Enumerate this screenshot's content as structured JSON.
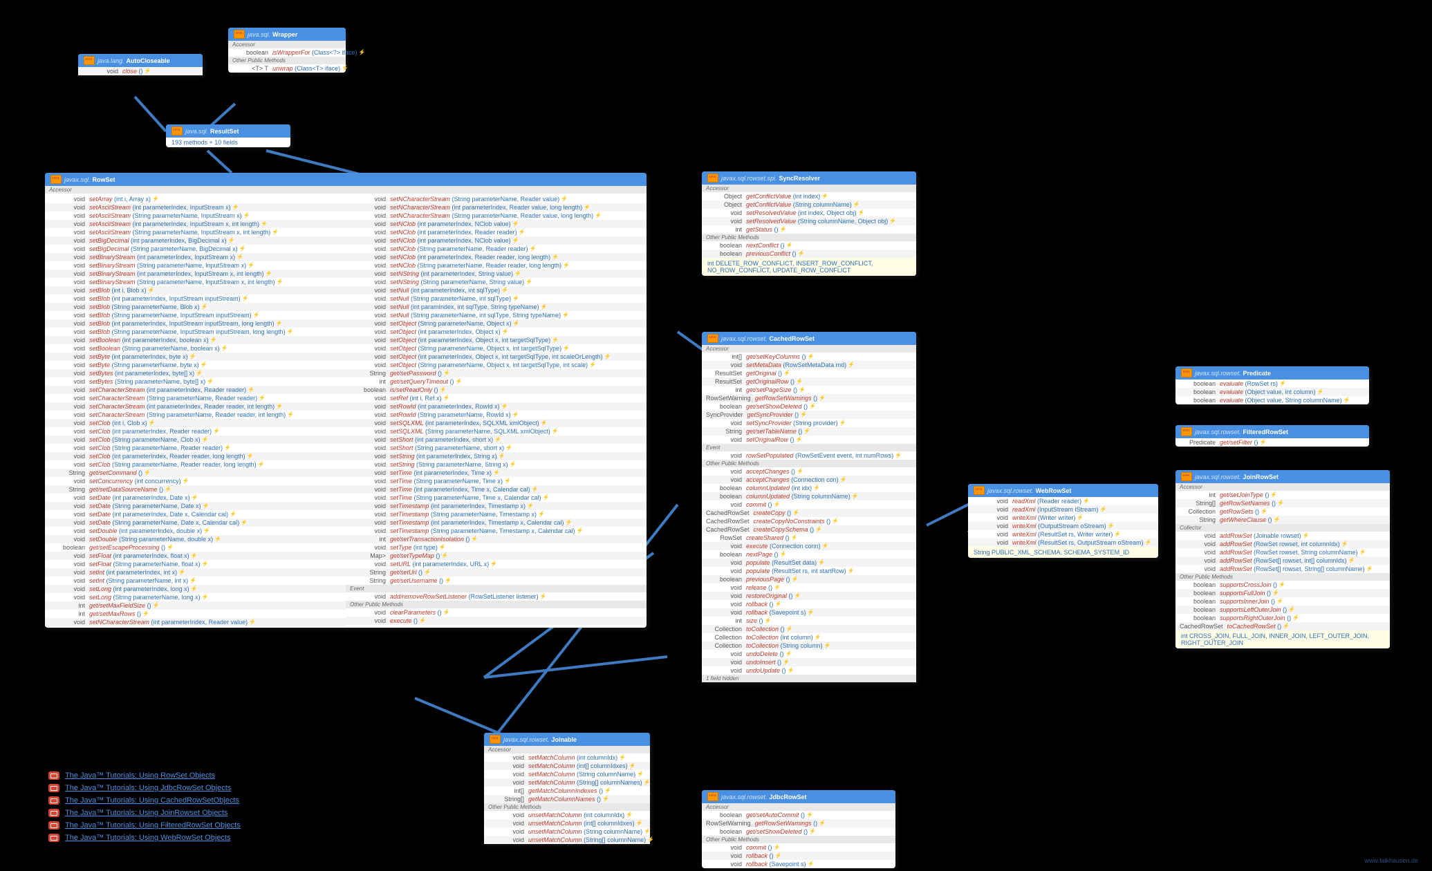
{
  "wrapper": {
    "pkg": "java.sql.",
    "name": "Wrapper",
    "sec1": "Accessor",
    "r1_ret": "boolean",
    "r1_m": "isWrapperFor",
    "r1_p": "(Class<?> iface)",
    "sec2": "Other Public Methods",
    "r2_ret": "<T> T",
    "r2_m": "unwrap",
    "r2_p": "(Class<T> iface)"
  },
  "autocloseable": {
    "pkg": "java.lang.",
    "name": "AutoCloseable",
    "r_ret": "void",
    "r_m": "close",
    "r_p": "()"
  },
  "resultset": {
    "pkg": "java.sql.",
    "name": "ResultSet",
    "info": "193 methods + 10 fields"
  },
  "rowset": {
    "pkg": "javax.sql.",
    "name": "RowSet",
    "sec1": "Accessor",
    "sec2": "Event",
    "col1": [
      [
        "void",
        "setArray",
        "(int i, Array x)"
      ],
      [
        "void",
        "setAsciiStream",
        "(int parameterIndex, InputStream x)"
      ],
      [
        "void",
        "setAsciiStream",
        "(String parameterName, InputStream x)"
      ],
      [
        "void",
        "setAsciiStream",
        "(int parameterIndex, InputStream x, int length)"
      ],
      [
        "void",
        "setAsciiStream",
        "(String parameterName, InputStream x, int length)"
      ],
      [
        "void",
        "setBigDecimal",
        "(int parameterIndex, BigDecimal x)"
      ],
      [
        "void",
        "setBigDecimal",
        "(String parameterName, BigDecimal x)"
      ],
      [
        "void",
        "setBinaryStream",
        "(int parameterIndex, InputStream x)"
      ],
      [
        "void",
        "setBinaryStream",
        "(String parameterName, InputStream x)"
      ],
      [
        "void",
        "setBinaryStream",
        "(int parameterIndex, InputStream x, int length)"
      ],
      [
        "void",
        "setBinaryStream",
        "(String parameterName, InputStream x, int length)"
      ],
      [
        "void",
        "setBlob",
        "(int i, Blob x)"
      ],
      [
        "void",
        "setBlob",
        "(int parameterIndex, InputStream inputStream)"
      ],
      [
        "void",
        "setBlob",
        "(String parameterName, Blob x)"
      ],
      [
        "void",
        "setBlob",
        "(String parameterName, InputStream inputStream)"
      ],
      [
        "void",
        "setBlob",
        "(int parameterIndex, InputStream inputStream, long length)"
      ],
      [
        "void",
        "setBlob",
        "(String parameterName, InputStream inputStream, long length)"
      ],
      [
        "void",
        "setBoolean",
        "(int parameterIndex, boolean x)"
      ],
      [
        "void",
        "setBoolean",
        "(String parameterName, boolean x)"
      ],
      [
        "void",
        "setByte",
        "(int parameterIndex, byte x)"
      ],
      [
        "void",
        "setByte",
        "(String parameterName, byte x)"
      ],
      [
        "void",
        "setBytes",
        "(int parameterIndex, byte[] x)"
      ],
      [
        "void",
        "setBytes",
        "(String parameterName, byte[] x)"
      ],
      [
        "void",
        "setCharacterStream",
        "(int parameterIndex, Reader reader)"
      ],
      [
        "void",
        "setCharacterStream",
        "(String parameterName, Reader reader)"
      ],
      [
        "void",
        "setCharacterStream",
        "(int parameterIndex, Reader reader, int length)"
      ],
      [
        "void",
        "setCharacterStream",
        "(String parameterName, Reader reader, int length)"
      ],
      [
        "void",
        "setClob",
        "(int i, Clob x)"
      ],
      [
        "void",
        "setClob",
        "(int parameterIndex, Reader reader)"
      ],
      [
        "void",
        "setClob",
        "(String parameterName, Clob x)"
      ],
      [
        "void",
        "setClob",
        "(String parameterName, Reader reader)"
      ],
      [
        "void",
        "setClob",
        "(int parameterIndex, Reader reader, long length)"
      ],
      [
        "void",
        "setClob",
        "(String parameterName, Reader reader, long length)"
      ],
      [
        "String",
        "get/setCommand",
        "()"
      ],
      [
        "void",
        "setConcurrency",
        "(int concurrency)"
      ],
      [
        "String",
        "get/setDataSourceName",
        "()"
      ],
      [
        "void",
        "setDate",
        "(int parameterIndex, Date x)"
      ],
      [
        "void",
        "setDate",
        "(String parameterName, Date x)"
      ],
      [
        "void",
        "setDate",
        "(int parameterIndex, Date x, Calendar cal)"
      ],
      [
        "void",
        "setDate",
        "(String parameterName, Date x, Calendar cal)"
      ],
      [
        "void",
        "setDouble",
        "(int parameterIndex, double x)"
      ],
      [
        "void",
        "setDouble",
        "(String parameterName, double x)"
      ],
      [
        "boolean",
        "get/setEscapeProcessing",
        "()"
      ],
      [
        "void",
        "setFloat",
        "(int parameterIndex, float x)"
      ],
      [
        "void",
        "setFloat",
        "(String parameterName, float x)"
      ],
      [
        "void",
        "setInt",
        "(int parameterIndex, int x)"
      ],
      [
        "void",
        "setInt",
        "(String parameterName, int x)"
      ],
      [
        "void",
        "setLong",
        "(int parameterIndex, long x)"
      ],
      [
        "void",
        "setLong",
        "(String parameterName, long x)"
      ],
      [
        "int",
        "get/setMaxFieldSize",
        "()"
      ],
      [
        "int",
        "get/setMaxRows",
        "()"
      ],
      [
        "void",
        "setNCharacterStream",
        "(int parameterIndex, Reader value)"
      ]
    ],
    "col2": [
      [
        "void",
        "setNCharacterStream",
        "(String parameterName, Reader value)"
      ],
      [
        "void",
        "setNCharacterStream",
        "(int parameterIndex, Reader value, long length)"
      ],
      [
        "void",
        "setNCharacterStream",
        "(String parameterName, Reader value, long length)"
      ],
      [
        "void",
        "setNClob",
        "(int parameterIndex, NClob value)"
      ],
      [
        "void",
        "setNClob",
        "(int parameterIndex, Reader reader)"
      ],
      [
        "void",
        "setNClob",
        "(int parameterIndex, NClob value)"
      ],
      [
        "void",
        "setNClob",
        "(String parameterName, Reader reader)"
      ],
      [
        "void",
        "setNClob",
        "(int parameterIndex, Reader reader, long length)"
      ],
      [
        "void",
        "setNClob",
        "(String parameterName, Reader reader, long length)"
      ],
      [
        "void",
        "setNString",
        "(int parameterIndex, String value)"
      ],
      [
        "void",
        "setNString",
        "(String parameterName, String value)"
      ],
      [
        "void",
        "setNull",
        "(int parameterIndex, int sqlType)"
      ],
      [
        "void",
        "setNull",
        "(String parameterName, int sqlType)"
      ],
      [
        "void",
        "setNull",
        "(int paramIndex, int sqlType, String typeName)"
      ],
      [
        "void",
        "setNull",
        "(String parameterName, int sqlType, String typeName)"
      ],
      [
        "void",
        "setObject",
        "(String parameterName, Object x)"
      ],
      [
        "void",
        "setObject",
        "(int parameterIndex, Object x)"
      ],
      [
        "void",
        "setObject",
        "(int parameterIndex, Object x, int targetSqlType)"
      ],
      [
        "void",
        "setObject",
        "(String parameterName, Object x, int targetSqlType)"
      ],
      [
        "void",
        "setObject",
        "(int parameterIndex, Object x, int targetSqlType, int scaleOrLength)"
      ],
      [
        "void",
        "setObject",
        "(String parameterName, Object x, int targetSqlType, int scale)"
      ],
      [
        "String",
        "get/setPassword",
        "()"
      ],
      [
        "int",
        "get/setQueryTimeout",
        "()"
      ],
      [
        "boolean",
        "is/setReadOnly",
        "()"
      ],
      [
        "void",
        "setRef",
        "(int i, Ref x)"
      ],
      [
        "void",
        "setRowId",
        "(int parameterIndex, RowId x)"
      ],
      [
        "void",
        "setRowId",
        "(String parameterName, RowId x)"
      ],
      [
        "void",
        "setSQLXML",
        "(int parameterIndex, SQLXML xmlObject)"
      ],
      [
        "void",
        "setSQLXML",
        "(String parameterName, SQLXML xmlObject)"
      ],
      [
        "void",
        "setShort",
        "(int parameterIndex, short x)"
      ],
      [
        "void",
        "setShort",
        "(String parameterName, short x)"
      ],
      [
        "void",
        "setString",
        "(int parameterIndex, String x)"
      ],
      [
        "void",
        "setString",
        "(String parameterName, String x)"
      ],
      [
        "void",
        "setTime",
        "(int parameterIndex, Time x)"
      ],
      [
        "void",
        "setTime",
        "(String parameterName, Time x)"
      ],
      [
        "void",
        "setTime",
        "(int parameterIndex, Time x, Calendar cal)"
      ],
      [
        "void",
        "setTime",
        "(String parameterName, Time x, Calendar cal)"
      ],
      [
        "void",
        "setTimestamp",
        "(int parameterIndex, Timestamp x)"
      ],
      [
        "void",
        "setTimestamp",
        "(String parameterName, Timestamp x)"
      ],
      [
        "void",
        "setTimestamp",
        "(int parameterIndex, Timestamp x, Calendar cal)"
      ],
      [
        "void",
        "setTimestamp",
        "(String parameterName, Timestamp x, Calendar cal)"
      ],
      [
        "int",
        "get/setTransactionIsolation",
        "()"
      ],
      [
        "void",
        "setType",
        "(int type)"
      ],
      [
        "Map<String, Class<?>>",
        "get/setTypeMap",
        "()"
      ],
      [
        "void",
        "setURL",
        "(int parameterIndex, URL x)"
      ],
      [
        "String",
        "get/setUrl",
        "()"
      ],
      [
        "String",
        "get/setUsername",
        "()"
      ]
    ],
    "evt": [
      [
        "void",
        "add/removeRowSetListener",
        "(RowSetListener listener)"
      ]
    ],
    "other": [
      [
        "void",
        "clearParameters",
        "()"
      ],
      [
        "void",
        "execute",
        "()"
      ]
    ],
    "sec3": "Other Public Methods"
  },
  "joinable": {
    "pkg": "javax.sql.rowset.",
    "name": "Joinable",
    "sec1": "Accessor",
    "sec2": "Other Public Methods",
    "acc": [
      [
        "void",
        "setMatchColumn",
        "(int columnIdx)"
      ],
      [
        "void",
        "setMatchColumn",
        "(int[] columnIdxes)"
      ],
      [
        "void",
        "setMatchColumn",
        "(String columnName)"
      ],
      [
        "void",
        "setMatchColumn",
        "(String[] columnNames)"
      ],
      [
        "int[]",
        "getMatchColumnIndexes",
        "()"
      ],
      [
        "String[]",
        "getMatchColumnNames",
        "()"
      ]
    ],
    "oth": [
      [
        "void",
        "unsetMatchColumn",
        "(int columnIdx)"
      ],
      [
        "void",
        "unsetMatchColumn",
        "(int[] columnIdxes)"
      ],
      [
        "void",
        "unsetMatchColumn",
        "(String columnName)"
      ],
      [
        "void",
        "unsetMatchColumn",
        "(String[] columnName)"
      ]
    ]
  },
  "syncresolver": {
    "pkg": "javax.sql.rowset.spi.",
    "name": "SyncResolver",
    "sec1": "Accessor",
    "sec2": "Other Public Methods",
    "acc": [
      [
        "Object",
        "getConflictValue",
        "(int index)"
      ],
      [
        "Object",
        "getConflictValue",
        "(String columnName)"
      ],
      [
        "void",
        "setResolvedValue",
        "(int index, Object obj)"
      ],
      [
        "void",
        "setResolvedValue",
        "(String columnName, Object obj)"
      ],
      [
        "int",
        "getStatus",
        "()"
      ]
    ],
    "oth": [
      [
        "boolean",
        "nextConflict",
        "()"
      ],
      [
        "boolean",
        "previousConflict",
        "()"
      ]
    ],
    "flds": "int DELETE_ROW_CONFLICT, INSERT_ROW_CONFLICT, NO_ROW_CONFLICT, UPDATE_ROW_CONFLICT"
  },
  "cachedrowset": {
    "pkg": "javax.sql.rowset.",
    "name": "CachedRowSet",
    "sec1": "Accessor",
    "sec2": "Event",
    "sec3": "Other Public Methods",
    "acc": [
      [
        "int[]",
        "get/setKeyColumns",
        "()"
      ],
      [
        "void",
        "setMetaData",
        "(RowSetMetaData md)"
      ],
      [
        "ResultSet",
        "getOriginal",
        "()"
      ],
      [
        "ResultSet",
        "getOriginalRow",
        "()"
      ],
      [
        "int",
        "get/setPageSize",
        "()"
      ],
      [
        "RowSetWarning",
        "getRowSetWarnings",
        "()"
      ],
      [
        "boolean",
        "get/setShowDeleted",
        "()"
      ],
      [
        "SyncProvider",
        "getSyncProvider",
        "()"
      ],
      [
        "void",
        "setSyncProvider",
        "(String provider)"
      ],
      [
        "String",
        "get/setTableName",
        "()"
      ],
      [
        "void",
        "setOriginalRow",
        "()"
      ]
    ],
    "evt": [
      [
        "void",
        "rowSetPopulated",
        "(RowSetEvent event, int numRows)"
      ]
    ],
    "oth": [
      [
        "void",
        "acceptChanges",
        "()"
      ],
      [
        "void",
        "acceptChanges",
        "(Connection con)"
      ],
      [
        "boolean",
        "columnUpdated",
        "(int idx)"
      ],
      [
        "boolean",
        "columnUpdated",
        "(String columnName)"
      ],
      [
        "void",
        "commit",
        "()"
      ],
      [
        "CachedRowSet",
        "createCopy",
        "()"
      ],
      [
        "CachedRowSet",
        "createCopyNoConstraints",
        "()"
      ],
      [
        "CachedRowSet",
        "createCopySchema",
        "()"
      ],
      [
        "RowSet",
        "createShared",
        "()"
      ],
      [
        "void",
        "execute",
        "(Connection conn)"
      ],
      [
        "boolean",
        "nextPage",
        "()"
      ],
      [
        "void",
        "populate",
        "(ResultSet data)"
      ],
      [
        "void",
        "populate",
        "(ResultSet rs, int startRow)"
      ],
      [
        "boolean",
        "previousPage",
        "()"
      ],
      [
        "void",
        "release",
        "()"
      ],
      [
        "void",
        "restoreOriginal",
        "()"
      ],
      [
        "void",
        "rollback",
        "()"
      ],
      [
        "void",
        "rollback",
        "(Savepoint s)"
      ],
      [
        "int",
        "size",
        "()"
      ],
      [
        "Collection<?>",
        "toCollection",
        "()"
      ],
      [
        "Collection<?>",
        "toCollection",
        "(int column)"
      ],
      [
        "Collection<?>",
        "toCollection",
        "(String column)"
      ],
      [
        "void",
        "undoDelete",
        "()"
      ],
      [
        "void",
        "undoInsert",
        "()"
      ],
      [
        "void",
        "undoUpdate",
        "()"
      ]
    ],
    "hidden": "1 field    hidden"
  },
  "jdbcrowset": {
    "pkg": "javax.sql.rowset.",
    "name": "JdbcRowSet",
    "sec1": "Accessor",
    "sec2": "Other Public Methods",
    "acc": [
      [
        "boolean",
        "get/setAutoCommit",
        "()"
      ],
      [
        "RowSetWarning",
        "getRowSetWarnings",
        "()"
      ],
      [
        "boolean",
        "get/setShowDeleted",
        "()"
      ]
    ],
    "oth": [
      [
        "void",
        "commit",
        "()"
      ],
      [
        "void",
        "rollback",
        "()"
      ],
      [
        "void",
        "rollback",
        "(Savepoint s)"
      ]
    ]
  },
  "webrowset": {
    "pkg": "javax.sql.rowset.",
    "name": "WebRowSet",
    "rows": [
      [
        "void",
        "readXml",
        "(Reader reader)"
      ],
      [
        "void",
        "readXml",
        "(InputStream iStream)"
      ],
      [
        "void",
        "writeXml",
        "(Writer writer)"
      ],
      [
        "void",
        "writeXml",
        "(OutputStream oStream)"
      ],
      [
        "void",
        "writeXml",
        "(ResultSet rs, Writer writer)"
      ],
      [
        "void",
        "writeXml",
        "(ResultSet rs, OutputStream oStream)"
      ]
    ],
    "flds": "String PUBLIC_XML_SCHEMA, SCHEMA_SYSTEM_ID"
  },
  "predicate": {
    "pkg": "javax.sql.rowset.",
    "name": "Predicate",
    "rows": [
      [
        "boolean",
        "evaluate",
        "(RowSet rs)"
      ],
      [
        "boolean",
        "evaluate",
        "(Object value, int column)"
      ],
      [
        "boolean",
        "evaluate",
        "(Object value, String columnName)"
      ]
    ]
  },
  "filteredrowset": {
    "pkg": "javax.sql.rowset.",
    "name": "FilteredRowSet",
    "rows": [
      [
        "Predicate",
        "get/setFilter",
        "()"
      ]
    ]
  },
  "joinrowset": {
    "pkg": "javax.sql.rowset.",
    "name": "JoinRowSet",
    "sec1": "Accessor",
    "sec2": "Collector",
    "sec3": "Other Public Methods",
    "acc": [
      [
        "int",
        "get/setJoinType",
        "()"
      ],
      [
        "String[]",
        "getRowSetNames",
        "()"
      ],
      [
        "Collection<?>",
        "getRowSets",
        "()"
      ],
      [
        "String",
        "getWhereClause",
        "()"
      ]
    ],
    "coll": [
      [
        "void",
        "addRowSet",
        "(Joinable rowset)"
      ],
      [
        "void",
        "addRowSet",
        "(RowSet rowset, int columnIdx)"
      ],
      [
        "void",
        "addRowSet",
        "(RowSet rowset, String columnName)"
      ],
      [
        "void",
        "addRowSet",
        "(RowSet[] rowset, int[] columnIdx)"
      ],
      [
        "void",
        "addRowSet",
        "(RowSet[] rowset, String[] columnName)"
      ]
    ],
    "oth": [
      [
        "boolean",
        "supportsCrossJoin",
        "()"
      ],
      [
        "boolean",
        "supportsFullJoin",
        "()"
      ],
      [
        "boolean",
        "supportsInnerJoin",
        "()"
      ],
      [
        "boolean",
        "supportsLeftOuterJoin",
        "()"
      ],
      [
        "boolean",
        "supportsRightOuterJoin",
        "()"
      ],
      [
        "CachedRowSet",
        "toCachedRowSet",
        "()"
      ]
    ],
    "flds": "int CROSS_JOIN, FULL_JOIN, INNER_JOIN, LEFT_OUTER_JOIN, RIGHT_OUTER_JOIN"
  },
  "links": [
    "The Java™ Tutorials: Using RowSet Objects",
    "The Java™ Tutorials: Using JdbcRowSet Objects",
    "The Java™ Tutorials: Using CachedRowSetObjects",
    "The Java™ Tutorials: Using JoinRowset Objects",
    "The Java™ Tutorials: Using FilteredRowSet Objects",
    "The Java™ Tutorials: Using WebRowSet Objects"
  ],
  "watermark": "www.falkhausen.de"
}
